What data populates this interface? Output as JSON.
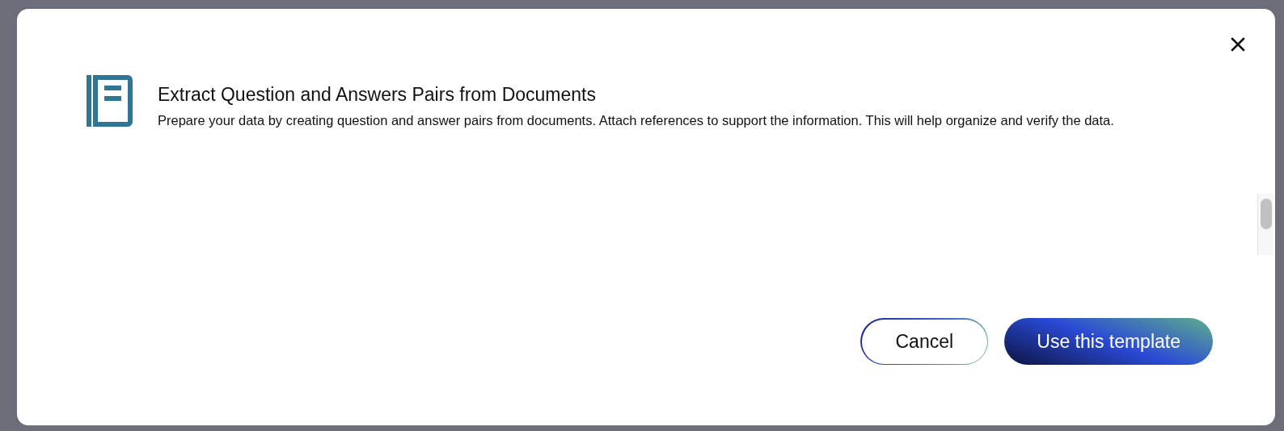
{
  "dialog": {
    "title": "Extract Question and Answers Pairs from Documents",
    "description": "Prepare your data by creating question and answer pairs from documents. Attach references to support the information. This will help organize and verify the data.",
    "buttons": [
      {
        "label": "Cancel",
        "kind": "secondary"
      },
      {
        "label": "Use this template",
        "kind": "primary"
      }
    ]
  }
}
